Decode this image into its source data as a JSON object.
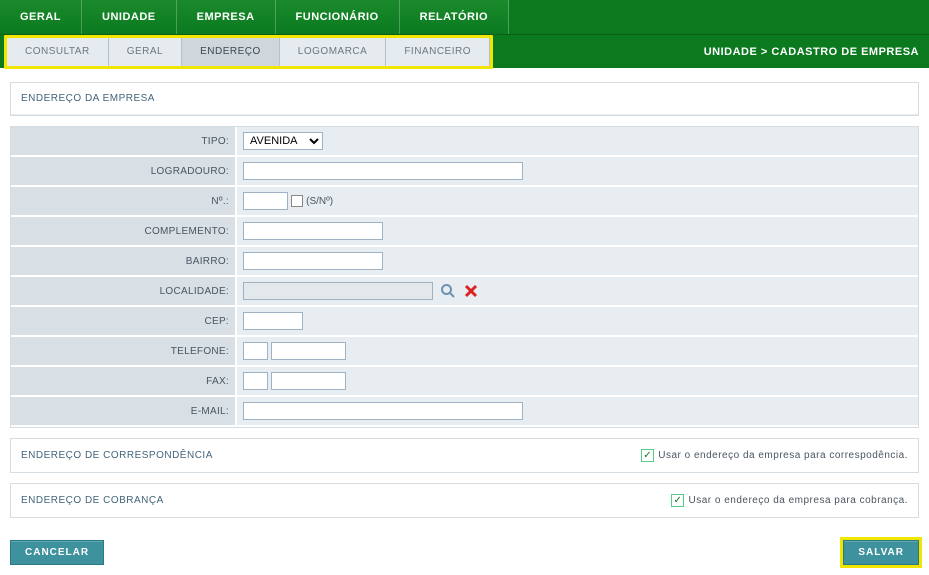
{
  "topmenu": {
    "items": [
      {
        "label": "GERAL"
      },
      {
        "label": "UNIDADE"
      },
      {
        "label": "EMPRESA"
      },
      {
        "label": "FUNCIONÁRIO"
      },
      {
        "label": "RELATÓRIO"
      }
    ]
  },
  "tabs": {
    "items": [
      {
        "label": "CONSULTAR"
      },
      {
        "label": "GERAL"
      },
      {
        "label": "ENDEREÇO"
      },
      {
        "label": "LOGOMARCA"
      },
      {
        "label": "FINANCEIRO"
      }
    ],
    "activeIndex": 2
  },
  "breadcrumb": "UNIDADE > CADASTRO DE EMPRESA",
  "sections": {
    "addr_title": "ENDEREÇO DA EMPRESA",
    "corr_title": "ENDEREÇO DE CORRESPONDÊNCIA",
    "cobr_title": "ENDEREÇO DE COBRANÇA"
  },
  "form": {
    "tipo_label": "TIPO:",
    "tipo_value": "AVENIDA",
    "logradouro_label": "LOGRADOURO:",
    "numero_label": "Nº.:",
    "sn_label": "(S/Nº)",
    "complemento_label": "COMPLEMENTO:",
    "bairro_label": "BAIRRO:",
    "localidade_label": "LOCALIDADE:",
    "cep_label": "CEP:",
    "telefone_label": "TELEFONE:",
    "fax_label": "FAX:",
    "email_label": "E-MAIL:"
  },
  "checks": {
    "corr_label": "Usar o endereço da empresa para correspodência.",
    "cobr_label": "Usar o endereço da empresa para cobrança.",
    "checkmark": "✓"
  },
  "buttons": {
    "cancel": "CANCELAR",
    "save": "SALVAR"
  }
}
